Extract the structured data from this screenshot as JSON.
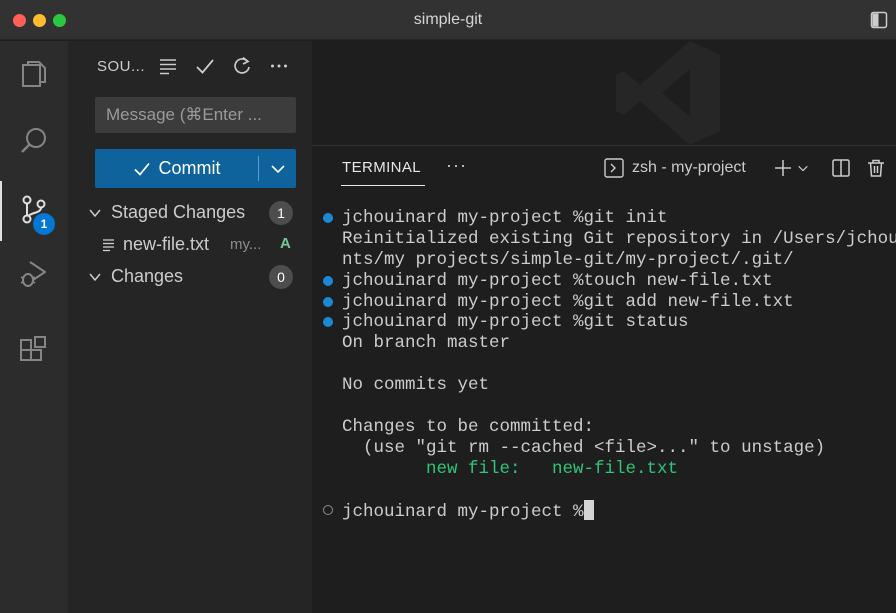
{
  "window": {
    "title": "simple-git"
  },
  "activity_bar": {
    "items": [
      {
        "name": "explorer",
        "icon": "files-icon"
      },
      {
        "name": "search",
        "icon": "search-icon"
      },
      {
        "name": "source-control",
        "icon": "source-control-icon",
        "badge": "1",
        "active": true
      },
      {
        "name": "run-debug",
        "icon": "run-debug-icon"
      },
      {
        "name": "extensions",
        "icon": "extensions-icon"
      }
    ]
  },
  "sidebar": {
    "title": "SOU...",
    "message_placeholder": "Message (⌘Enter ...",
    "message_value": "",
    "commit_label": "Commit",
    "staged": {
      "label": "Staged Changes",
      "count": "1"
    },
    "staged_files": [
      {
        "name": "new-file.txt",
        "dir": "my...",
        "status": "A"
      }
    ],
    "changes": {
      "label": "Changes",
      "count": "0"
    }
  },
  "panel": {
    "tab_label": "TERMINAL",
    "more": "···",
    "terminal_name": "zsh - my-project"
  },
  "terminal": {
    "lines": [
      {
        "marker": "filled",
        "text": "jchouinard my-project %git init"
      },
      {
        "marker": "none",
        "text": "Reinitialized existing Git repository in /Users/jchouina"
      },
      {
        "marker": "none",
        "text": "nts/my projects/simple-git/my-project/.git/"
      },
      {
        "marker": "filled",
        "text": "jchouinard my-project %touch new-file.txt"
      },
      {
        "marker": "filled",
        "text": "jchouinard my-project %git add new-file.txt"
      },
      {
        "marker": "filled",
        "text": "jchouinard my-project %git status"
      },
      {
        "marker": "none",
        "text": "On branch master"
      },
      {
        "marker": "none",
        "text": ""
      },
      {
        "marker": "none",
        "text": "No commits yet"
      },
      {
        "marker": "none",
        "text": ""
      },
      {
        "marker": "none",
        "text": "Changes to be committed:"
      },
      {
        "marker": "none",
        "text": "  (use \"git rm --cached <file>...\" to unstage)"
      },
      {
        "marker": "none",
        "text": "        new file:   new-file.txt",
        "color": "green"
      },
      {
        "marker": "none",
        "text": ""
      },
      {
        "marker": "hollow",
        "text": "jchouinard my-project %",
        "cursor": true
      }
    ]
  },
  "colors": {
    "accent": "#0e639c",
    "badge": "#0078d4",
    "added": "#73c991",
    "terminal_green": "#2fc579"
  }
}
